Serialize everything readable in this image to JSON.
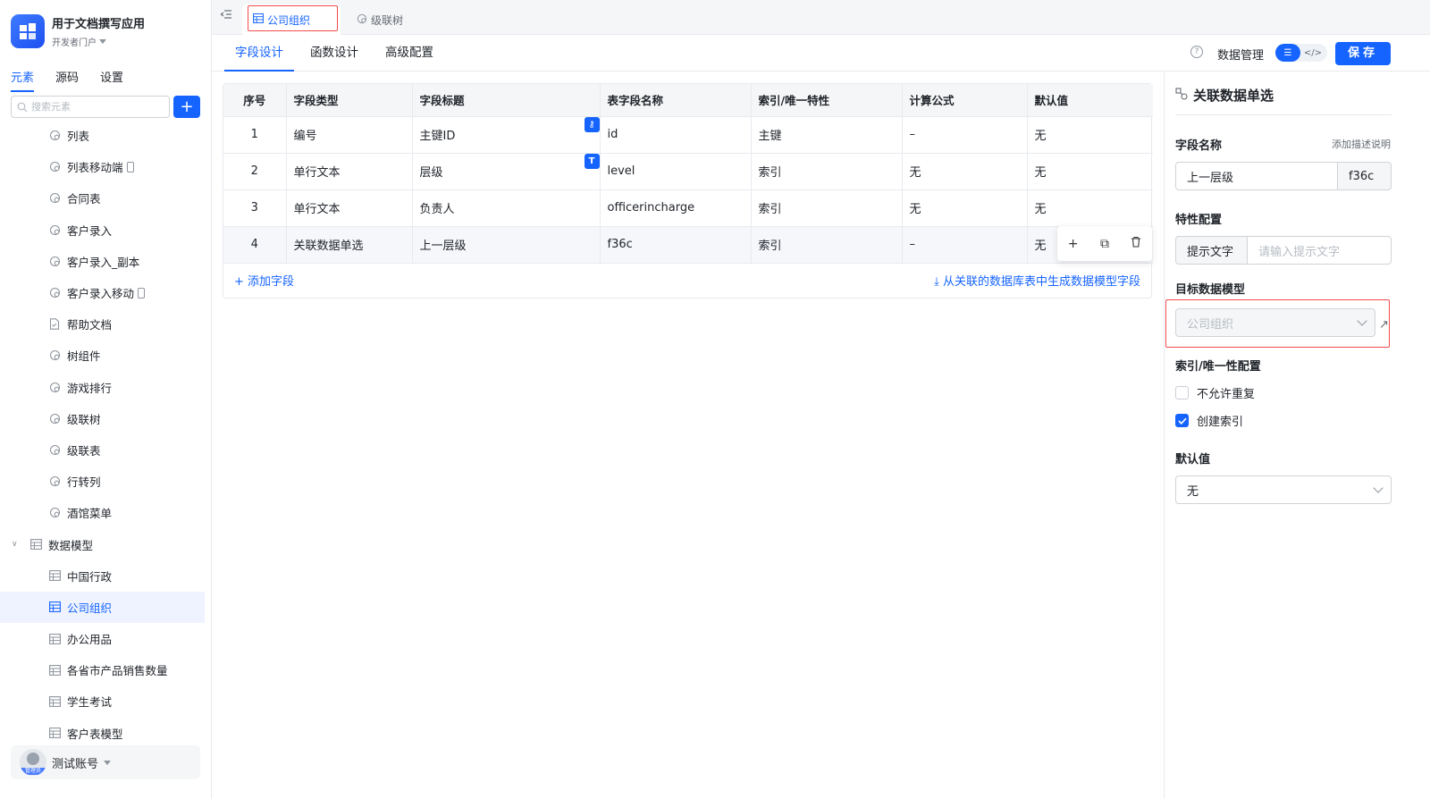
{
  "app": {
    "title": "用于文档撰写应用",
    "portal": "开发者门户"
  },
  "sidebar": {
    "tabs": [
      {
        "label": "元素",
        "active": true
      },
      {
        "label": "源码",
        "active": false
      },
      {
        "label": "设置",
        "active": false
      }
    ],
    "search_placeholder": "搜索元素",
    "add_label": "+",
    "items": [
      {
        "label": "列表",
        "icon": "component-icon"
      },
      {
        "label": "列表移动端",
        "icon": "component-icon",
        "mobile": true
      },
      {
        "label": "合同表",
        "icon": "component-icon"
      },
      {
        "label": "客户录入",
        "icon": "component-icon"
      },
      {
        "label": "客户录入_副本",
        "icon": "component-icon"
      },
      {
        "label": "客户录入移动",
        "icon": "component-icon",
        "mobile": true
      },
      {
        "label": "帮助文档",
        "icon": "document-icon"
      },
      {
        "label": "树组件",
        "icon": "component-icon"
      },
      {
        "label": "游戏排行",
        "icon": "component-icon"
      },
      {
        "label": "级联树",
        "icon": "component-icon"
      },
      {
        "label": "级联表",
        "icon": "component-icon"
      },
      {
        "label": "行转列",
        "icon": "component-icon"
      },
      {
        "label": "酒馆菜单",
        "icon": "component-icon"
      }
    ],
    "group": {
      "label": "数据模型",
      "icon": "table-icon",
      "expanded": true
    },
    "model_items": [
      {
        "label": "中国行政"
      },
      {
        "label": "公司组织",
        "selected": true
      },
      {
        "label": "办公用品"
      },
      {
        "label": "各省市产品销售数量"
      },
      {
        "label": "学生考试"
      },
      {
        "label": "客户表模型"
      }
    ],
    "account": {
      "name": "测试账号",
      "role": "管理员"
    }
  },
  "topbar": {
    "tabs": [
      {
        "label": "公司组织",
        "icon": "table-icon",
        "active": true
      },
      {
        "label": "级联树",
        "icon": "component-icon",
        "active": false
      }
    ]
  },
  "subbar": {
    "tabs": [
      {
        "label": "字段设计",
        "active": true
      },
      {
        "label": "函数设计",
        "active": false
      },
      {
        "label": "高级配置",
        "active": false
      }
    ],
    "data_mgmt": "数据管理",
    "help": "?",
    "save_label": "保存"
  },
  "table": {
    "columns": [
      "序号",
      "字段类型",
      "字段标题",
      "表字段名称",
      "索引/唯一特性",
      "计算公式",
      "默认值"
    ],
    "rows": [
      {
        "seq": "1",
        "type": "编号",
        "title": "主键ID",
        "name": "id",
        "index": "主键",
        "formula": "–",
        "default": "无",
        "badge": "key-icon"
      },
      {
        "seq": "2",
        "type": "单行文本",
        "title": "层级",
        "name": "level",
        "index": "索引",
        "formula": "无",
        "default": "无",
        "badge": "text-icon",
        "badge_text": "T"
      },
      {
        "seq": "3",
        "type": "单行文本",
        "title": "负责人",
        "name": "officerincharge",
        "index": "索引",
        "formula": "无",
        "default": "无"
      },
      {
        "seq": "4",
        "type": "关联数据单选",
        "title": "上一层级",
        "name": "f36c",
        "index": "索引",
        "formula": "–",
        "default": "无",
        "hover": true
      }
    ],
    "add_field": "+ 添加字段",
    "generate": "从关联的数据库表中生成数据模型字段",
    "row_actions": [
      "+",
      "⧉",
      "🗑"
    ]
  },
  "props": {
    "title": "关联数据单选",
    "field_name_label": "字段名称",
    "add_desc": "添加描述说明",
    "field_title_value": "上一层级",
    "field_key_value": "f36c",
    "feature_label": "特性配置",
    "hint_label": "提示文字",
    "hint_placeholder": "请输入提示文字",
    "target_label": "目标数据模型",
    "target_value": "公司组织",
    "ext_link": "↗",
    "index_label": "索引/唯一性配置",
    "checkbox_unique": {
      "label": "不允许重复",
      "checked": false
    },
    "checkbox_index": {
      "label": "创建索引",
      "checked": true
    },
    "default_label": "默认值",
    "default_value": "无"
  },
  "colors": {
    "primary": "#1664ff",
    "highlight_red": "#f24c4c"
  }
}
